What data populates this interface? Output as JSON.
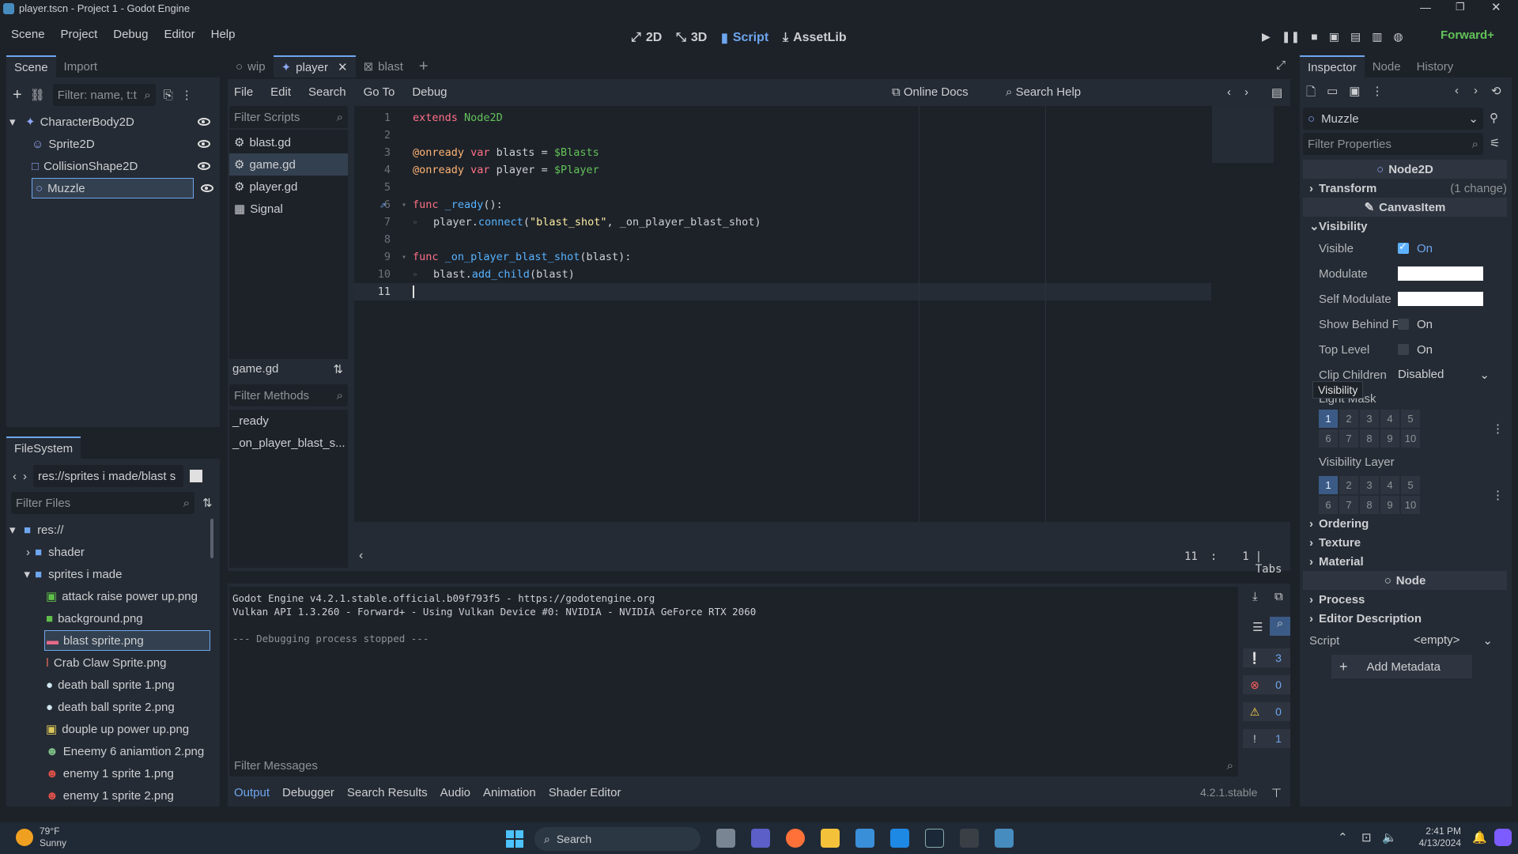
{
  "window": {
    "title": "player.tscn - Project 1 - Godot Engine"
  },
  "menu": [
    "Scene",
    "Project",
    "Debug",
    "Editor",
    "Help"
  ],
  "workspaces": [
    "2D",
    "3D",
    "Script",
    "AssetLib"
  ],
  "renderer": "Forward+",
  "scene_panel": {
    "tabs": [
      "Scene",
      "Import"
    ],
    "filter_placeholder": "Filter: name, t:t",
    "nodes": [
      "CharacterBody2D",
      "Sprite2D",
      "CollisionShape2D",
      "Muzzle"
    ]
  },
  "filesystem": {
    "tab": "FileSystem",
    "path": "res://sprites i made/blast s",
    "filter_placeholder": "Filter Files",
    "items": [
      "res://",
      "shader",
      "sprites i made",
      "attack raise power up.png",
      "background.png",
      "blast sprite.png",
      "Crab Claw Sprite.png",
      "death ball sprite 1.png",
      "death ball sprite 2.png",
      "douple up power up.png",
      "Eneemy 6 aniamtion 2.png",
      "enemy 1 sprite 1.png",
      "enemy 1 sprite 2.png"
    ]
  },
  "scene_tabs": [
    "wip",
    "player",
    "blast"
  ],
  "script_menu": [
    "File",
    "Edit",
    "Search",
    "Go To",
    "Debug"
  ],
  "script_help": {
    "docs": "Online Docs",
    "search": "Search Help"
  },
  "script_list": {
    "filter_placeholder": "Filter Scripts",
    "items": [
      "blast.gd",
      "game.gd",
      "player.gd",
      "Signal"
    ],
    "current": "game.gd",
    "methods_placeholder": "Filter Methods",
    "methods": [
      "_ready",
      "_on_player_blast_s..."
    ]
  },
  "code": {
    "line_numbers": [
      "1",
      "2",
      "3",
      "4",
      "5",
      "6",
      "7",
      "8",
      "9",
      "10",
      "11"
    ],
    "l1": [
      "extends",
      " Node2D"
    ],
    "l3": [
      "@onready",
      " var ",
      "blasts",
      " = ",
      "$Blasts"
    ],
    "l4": [
      "@onready",
      " var ",
      "player",
      " = ",
      "$Player"
    ],
    "l6": [
      "func",
      " _ready",
      "():"
    ],
    "l7": [
      "player.",
      "connect",
      "(",
      "\"blast_shot\"",
      ", _on_player_blast_shot)"
    ],
    "l9": [
      "func",
      " _on_player_blast_shot",
      "(blast):"
    ],
    "l10": [
      "blast.",
      "add_child",
      "(blast)"
    ]
  },
  "status": {
    "line": "11",
    "sep": ":",
    "col": "1",
    "indent": "| Tabs"
  },
  "output": {
    "lines": [
      "Godot Engine v4.2.1.stable.official.b09f793f5 - https://godotengine.org",
      "Vulkan API 1.3.260 - Forward+ - Using Vulkan Device #0: NVIDIA - NVIDIA GeForce RTX 2060",
      "",
      "--- Debugging process stopped ---"
    ],
    "counts": [
      "3",
      "0",
      "0",
      "1"
    ],
    "filter_placeholder": "Filter Messages"
  },
  "bottom_tabs": [
    "Output",
    "Debugger",
    "Search Results",
    "Audio",
    "Animation",
    "Shader Editor"
  ],
  "version": "4.2.1.stable",
  "inspector": {
    "tabs": [
      "Inspector",
      "Node",
      "History"
    ],
    "node": "Muzzle",
    "filter_placeholder": "Filter Properties",
    "class_node2d": "Node2D",
    "transform": "Transform",
    "transform_note": "(1 change)",
    "canvas_item": "CanvasItem",
    "visibility": "Visibility",
    "visible": {
      "label": "Visible",
      "value": "On"
    },
    "modulate": "Modulate",
    "self_modulate": "Self Modulate",
    "show_behind": {
      "label": "Show Behind P...",
      "value": "On"
    },
    "top_level": {
      "label": "Top Level",
      "value": "On"
    },
    "clip_children": {
      "label": "Clip Children",
      "value": "Disabled"
    },
    "tooltip": "Visibility",
    "light_mask": "Light Mask",
    "visibility_layer": "Visibility Layer",
    "layers": [
      "1",
      "2",
      "3",
      "4",
      "5",
      "6",
      "7",
      "8",
      "9",
      "10"
    ],
    "ordering": "Ordering",
    "texture": "Texture",
    "material": "Material",
    "class_node": "Node",
    "process": "Process",
    "editor_description": "Editor Description",
    "script": {
      "label": "Script",
      "value": "<empty>"
    },
    "add_metadata": "Add Metadata"
  },
  "taskbar": {
    "weather_temp": "79°F",
    "weather_desc": "Sunny",
    "search": "Search",
    "time": "2:41 PM",
    "date": "4/13/2024"
  }
}
